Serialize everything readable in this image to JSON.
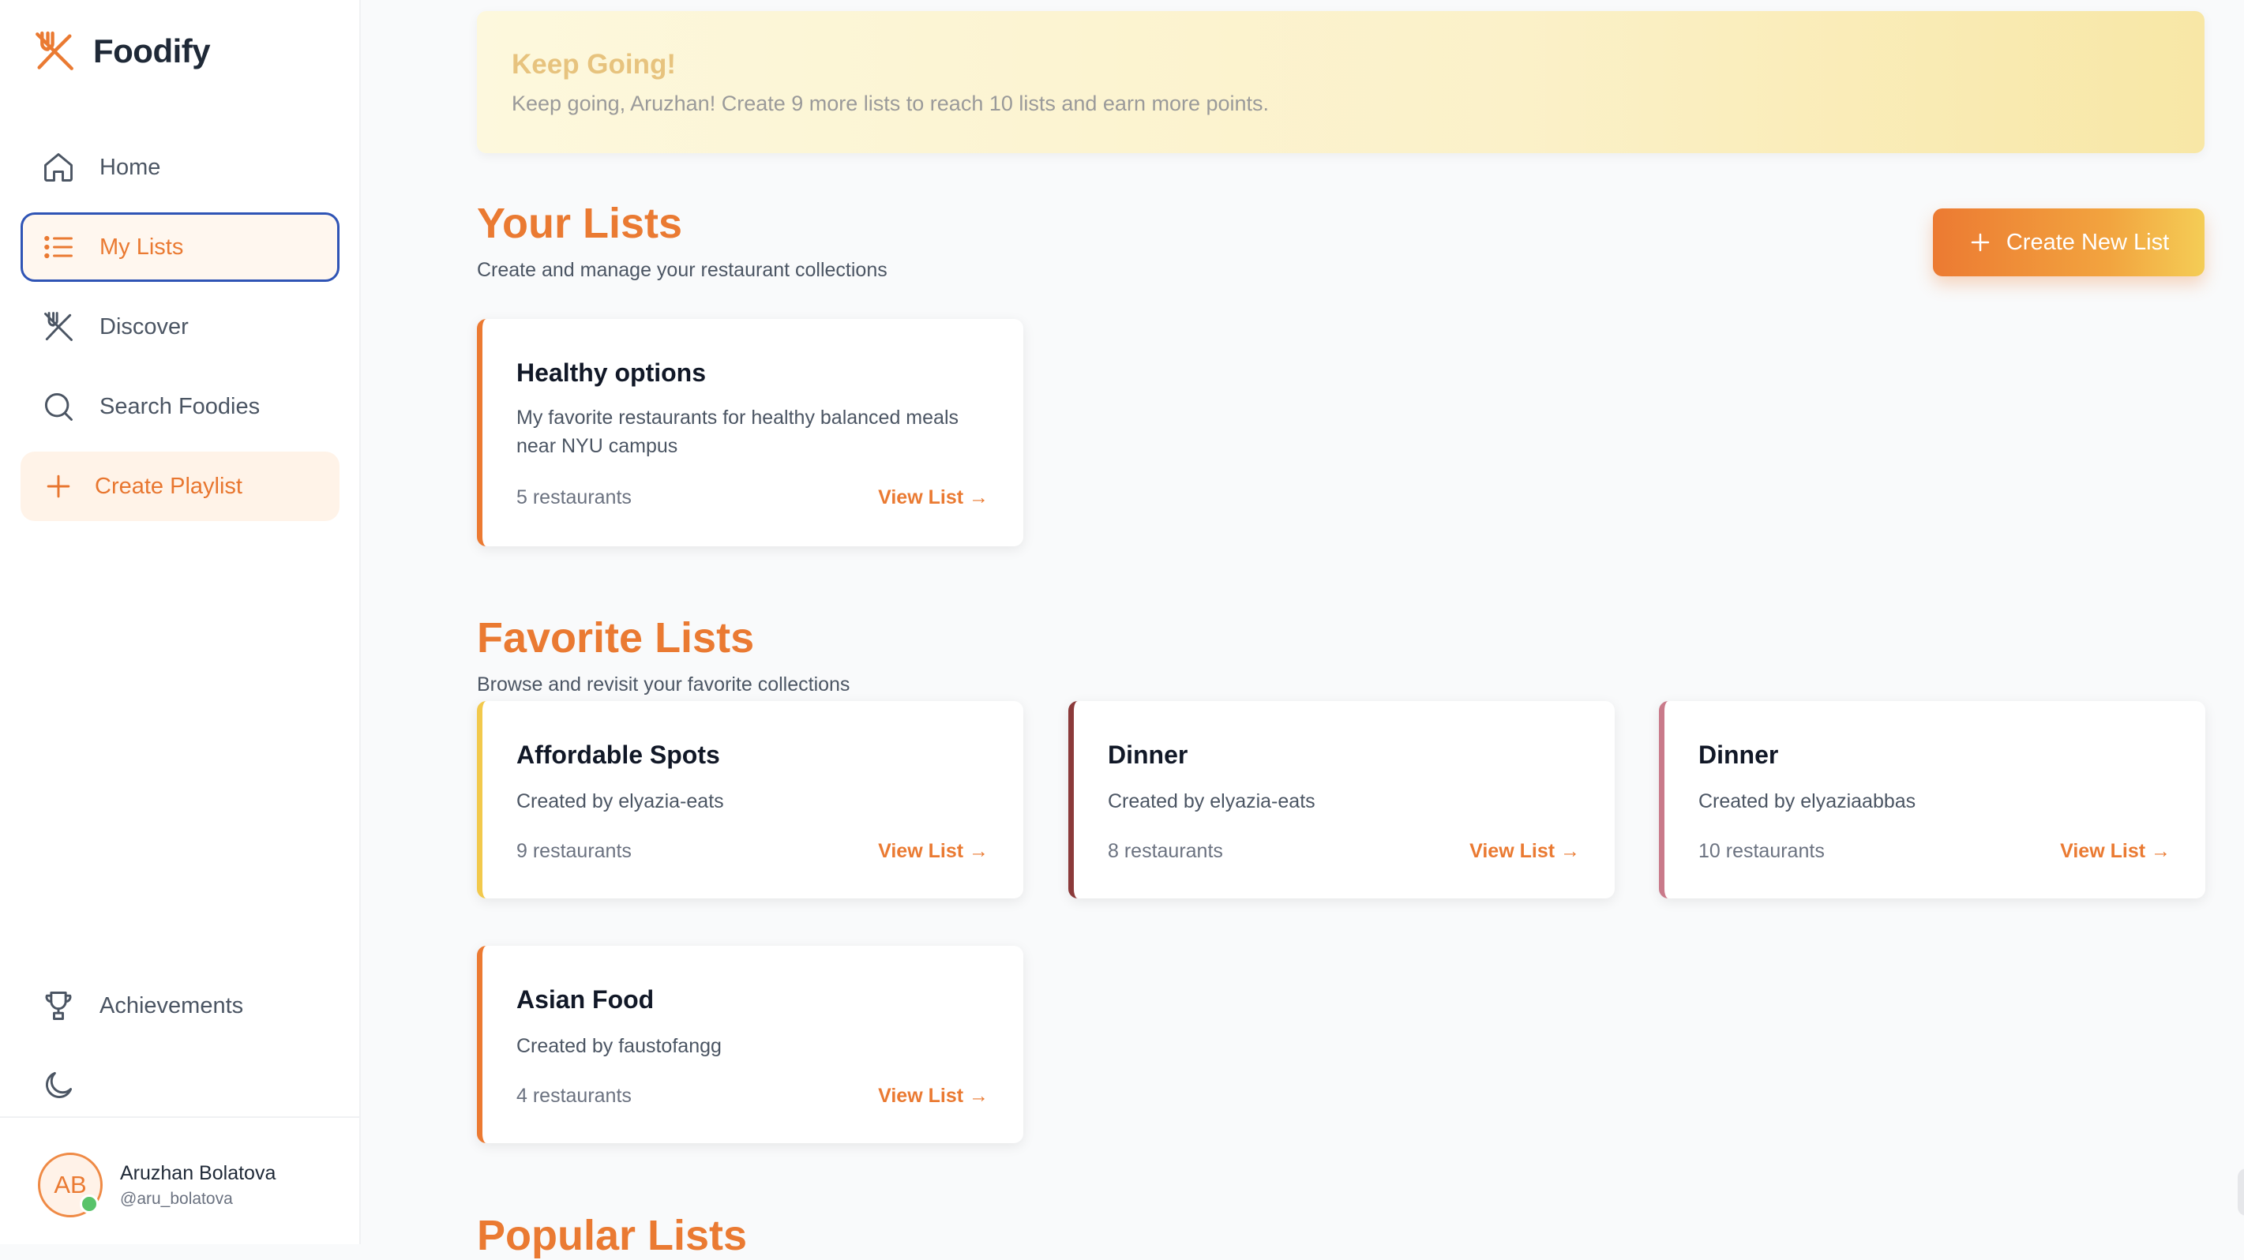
{
  "app": {
    "name": "Foodify",
    "brand_color": "#ea7a32"
  },
  "sidebar": {
    "nav": [
      {
        "label": "Home",
        "icon": "home-icon"
      },
      {
        "label": "My Lists",
        "icon": "list-icon",
        "active": true
      },
      {
        "label": "Discover",
        "icon": "utensils-icon"
      },
      {
        "label": "Search Foodies",
        "icon": "search-icon"
      },
      {
        "label": "Create Playlist",
        "icon": "plus-icon"
      }
    ],
    "bottom_nav": [
      {
        "label": "Achievements",
        "icon": "trophy-icon"
      },
      {
        "label": "",
        "icon": "moon-icon"
      }
    ],
    "profile": {
      "initials": "AB",
      "name": "Aruzhan Bolatova",
      "handle": "@aru_bolatova",
      "status": "online"
    }
  },
  "banner": {
    "title": "Keep Going!",
    "text": "Keep going, Aruzhan! Create 9 more lists to reach 10 lists and earn more points."
  },
  "your_lists": {
    "title": "Your Lists",
    "subtitle": "Create and manage your restaurant collections",
    "create_button": "Create New List",
    "cards": [
      {
        "title": "Healthy options",
        "description": "My favorite restaurants for healthy balanced meals near NYU campus",
        "count": "5 restaurants",
        "link": "View List →",
        "accent": "#ec7a32"
      }
    ]
  },
  "favorite_lists": {
    "title": "Favorite Lists",
    "subtitle": "Browse and revisit your favorite collections",
    "cards": [
      {
        "title": "Affordable Spots",
        "description": "Created by elyazia-eats",
        "count": "9 restaurants",
        "link": "View List →",
        "accent": "#f2c94c"
      },
      {
        "title": "Dinner",
        "description": "Created by elyazia-eats",
        "count": "8 restaurants",
        "link": "View List →",
        "accent": "#8b3a3a"
      },
      {
        "title": "Dinner",
        "description": "Created by elyaziaabbas",
        "count": "10 restaurants",
        "link": "View List →",
        "accent": "#c97a8a"
      },
      {
        "title": "Asian Food",
        "description": "Created by faustofangg",
        "count": "4 restaurants",
        "link": "View List →",
        "accent": "#ec7a32"
      }
    ]
  },
  "popular_lists": {
    "title": "Popular Lists"
  }
}
